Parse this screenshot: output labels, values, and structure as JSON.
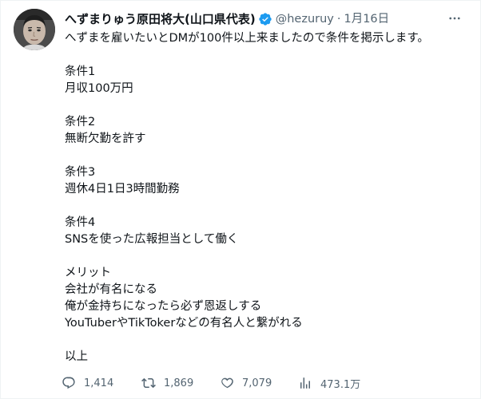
{
  "colors": {
    "text": "#0f1419",
    "secondary": "#536471",
    "verified_badge": "#1d9bf0"
  },
  "header": {
    "display_name": "へずまりゅう原田将大(山口県代表)",
    "verified_icon": "verified-badge-icon",
    "handle": "@hezuruy",
    "separator": "·",
    "date": "1月16日",
    "more_icon": "more-dots-icon"
  },
  "tweet": {
    "line1": "へずまを雇いたいとDMが100件以上来ましたので条件を掲示します。",
    "cond1_title": "条件1",
    "cond1_text": "月収100万円",
    "cond2_title": "条件2",
    "cond2_text": "無断欠勤を許す",
    "cond3_title": "条件3",
    "cond3_text": "週休4日1日3時間勤務",
    "cond4_title": "条件4",
    "cond4_text": "SNSを使った広報担当として働く",
    "merit_title": "メリット",
    "merit1": "会社が有名になる",
    "merit2": "俺が金持ちになったら必ず恩返しする",
    "merit3": "YouTuberやTikTokerなどの有名人と繋がれる",
    "end": "以上"
  },
  "actions": {
    "reply_count": "1,414",
    "retweet_count": "1,869",
    "like_count": "7,079",
    "view_count": "473.1万"
  }
}
